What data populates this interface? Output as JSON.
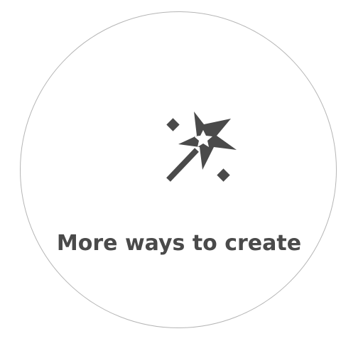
{
  "card": {
    "label": "More ways to create",
    "icon": "magic-wand-icon"
  },
  "colors": {
    "border": "#b5b5b5",
    "icon": "#4a4a4a",
    "text": "#4a4a4a",
    "background": "#ffffff"
  }
}
